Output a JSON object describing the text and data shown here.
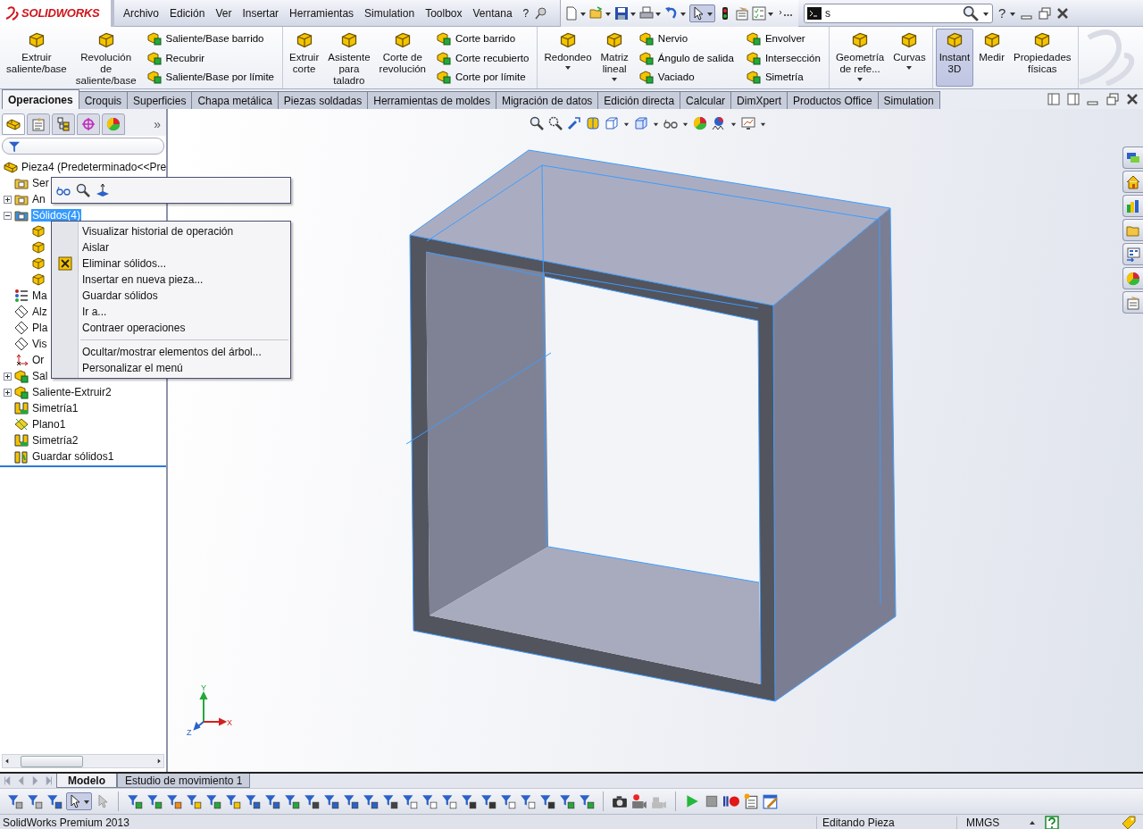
{
  "app": {
    "logo": "SOLIDWORKS"
  },
  "menu": [
    "Archivo",
    "Edición",
    "Ver",
    "Insertar",
    "Herramientas",
    "Simulation",
    "Toolbox",
    "Ventana",
    "?"
  ],
  "search": {
    "value": "s"
  },
  "help": "?",
  "ribbon": [
    [
      {
        "kind": "large",
        "label": "Extruir\nsaliente/base",
        "on": false
      },
      {
        "kind": "large",
        "label": "Revolución\nde\nsaliente/base",
        "on": false
      },
      {
        "kind": "stack",
        "items": [
          "Saliente/Base barrido",
          "Recubrir",
          "Saliente/Base por límite"
        ]
      }
    ],
    [
      {
        "kind": "large",
        "label": "Extruir\ncorte",
        "on": false
      },
      {
        "kind": "large",
        "label": "Asistente\npara\ntaladro",
        "on": false
      },
      {
        "kind": "large",
        "label": "Corte de\nrevolución",
        "on": false
      },
      {
        "kind": "stack",
        "items": [
          "Corte barrido",
          "Corte recubierto",
          "Corte por límite"
        ]
      }
    ],
    [
      {
        "kind": "large",
        "label": "Redondeo",
        "on": false,
        "dropdown": true
      },
      {
        "kind": "large",
        "label": "Matriz\nlineal",
        "on": false,
        "dropdown": true
      },
      {
        "kind": "stack",
        "items": [
          "Nervio",
          "Ángulo de salida",
          "Vaciado"
        ]
      },
      {
        "kind": "stack",
        "items": [
          "Envolver",
          "Intersección",
          "Simetría"
        ]
      }
    ],
    [
      {
        "kind": "large",
        "label": "Geometría\nde refe...",
        "on": false,
        "dropdown": true
      },
      {
        "kind": "large",
        "label": "Curvas",
        "on": false,
        "dropdown": true
      }
    ],
    [
      {
        "kind": "large",
        "label": "Instant\n3D",
        "on": true
      },
      {
        "kind": "large",
        "label": "Medir",
        "on": false
      },
      {
        "kind": "large",
        "label": "Propiedades\nfísicas",
        "on": false
      }
    ]
  ],
  "command_tabs": [
    {
      "label": "Operaciones",
      "selected": true
    },
    {
      "label": "Croquis",
      "selected": false
    },
    {
      "label": "Superficies",
      "selected": false
    },
    {
      "label": "Chapa metálica",
      "selected": false
    },
    {
      "label": "Piezas soldadas",
      "selected": false
    },
    {
      "label": "Herramientas de moldes",
      "selected": false
    },
    {
      "label": "Migración de datos",
      "selected": false
    },
    {
      "label": "Edición directa",
      "selected": false
    },
    {
      "label": "Calcular",
      "selected": false
    },
    {
      "label": "DimXpert",
      "selected": false
    },
    {
      "label": "Productos Office",
      "selected": false
    },
    {
      "label": "Simulation",
      "selected": false
    }
  ],
  "panel": {
    "tabs": [
      {
        "kind": "features",
        "selected": true
      },
      {
        "kind": "properties",
        "selected": false
      },
      {
        "kind": "configurations",
        "selected": false
      },
      {
        "kind": "dimxpert",
        "selected": false
      },
      {
        "kind": "display",
        "selected": false
      }
    ],
    "more": "»",
    "tree": {
      "kind": "part",
      "label": "Pieza4 (Predeterminado<<Pre",
      "selected": false,
      "children": [
        {
          "kind": "sensors",
          "label": "Ser",
          "selected": false
        },
        {
          "kind": "annotations",
          "label": "An",
          "selected": false,
          "expanded": false
        },
        {
          "kind": "bodies",
          "label": "Sólidos(4)",
          "selected": true,
          "expanded": true,
          "children": [
            {
              "kind": "body",
              "selected": false
            },
            {
              "kind": "body",
              "selected": false
            },
            {
              "kind": "body",
              "selected": false
            },
            {
              "kind": "body",
              "selected": false
            }
          ]
        },
        {
          "kind": "material",
          "label": "Ma",
          "selected": false
        },
        {
          "kind": "plane",
          "label": "Alz",
          "selected": false
        },
        {
          "kind": "plane",
          "label": "Pla",
          "selected": false
        },
        {
          "kind": "plane",
          "label": "Vis",
          "selected": false
        },
        {
          "kind": "origin",
          "label": "Or",
          "selected": false
        },
        {
          "kind": "extrude",
          "label": "Sal",
          "selected": false,
          "expanded": false
        },
        {
          "kind": "extrude",
          "label": "Saliente-Extruir2",
          "selected": false,
          "expanded": false
        },
        {
          "kind": "mirror",
          "label": "Simetría1",
          "selected": false
        },
        {
          "kind": "ref-plane",
          "label": "Plano1",
          "selected": false
        },
        {
          "kind": "mirror",
          "label": "Simetría2",
          "selected": false
        },
        {
          "kind": "save-bodies",
          "label": "Guardar sólidos1",
          "selected": false
        }
      ]
    }
  },
  "context_menu": [
    {
      "kind": "plain",
      "label": "Visualizar historial de operación",
      "separator_before": false
    },
    {
      "kind": "plain",
      "label": "Aislar",
      "separator_before": false
    },
    {
      "kind": "delete",
      "label": "Eliminar sólidos...",
      "separator_before": false
    },
    {
      "kind": "plain",
      "label": "Insertar en nueva pieza...",
      "separator_before": false
    },
    {
      "kind": "plain",
      "label": "Guardar sólidos",
      "separator_before": false
    },
    {
      "kind": "plain",
      "label": "Ir a...",
      "separator_before": false
    },
    {
      "kind": "plain",
      "label": "Contraer operaciones",
      "separator_before": false
    },
    {
      "kind": "plain",
      "label": "Ocultar/mostrar elementos del árbol...",
      "separator_before": true
    },
    {
      "kind": "plain",
      "label": "Personalizar el menú",
      "separator_before": false
    }
  ],
  "triad": {
    "y": "Y",
    "x": "X",
    "z": "Z"
  },
  "bottom_tabs": [
    {
      "label": "Modelo",
      "selected": true
    },
    {
      "label": "Estudio de movimiento 1",
      "selected": false
    }
  ],
  "status_bar": {
    "product": "SolidWorks Premium 2013",
    "mode": "Editando Pieza",
    "units": "MMGS"
  }
}
